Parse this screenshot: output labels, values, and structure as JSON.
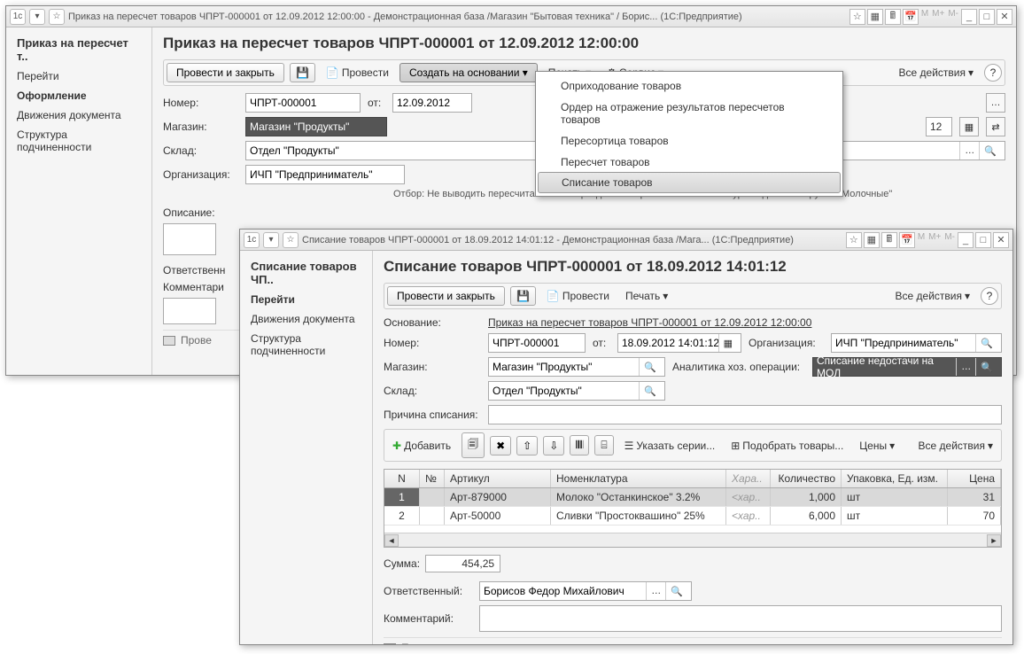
{
  "main": {
    "title": "Приказ на пересчет товаров ЧПРТ-000001 от 12.09.2012 12:00:00 - Демонстрационная база /Магазин \"Бытовая техника\" / Борис...  (1С:Предприятие)",
    "nav": {
      "head": "Приказ на пересчет т..",
      "items": [
        "Перейти",
        "Оформление",
        "Движения документа",
        "Структура подчиненности"
      ],
      "selected": 1
    },
    "page_title": "Приказ на пересчет товаров ЧПРТ-000001 от 12.09.2012 12:00:00",
    "toolbar": {
      "post_close": "Провести и закрыть",
      "post": "Провести",
      "create_based": "Создать на основании",
      "print": "Печать",
      "service": "Сервис",
      "all_actions": "Все действия",
      "help": "?"
    },
    "dropdown": {
      "items": [
        "Оприходование товаров",
        "Ордер на отражение результатов пересчетов товаров",
        "Пересортица товаров",
        "Пересчет товаров",
        "Списание товаров"
      ],
      "selected": 4
    },
    "labels": {
      "number": "Номер:",
      "from": "от:",
      "store": "Магазин:",
      "warehouse": "Склад:",
      "org": "Организация:",
      "desc": "Описание:",
      "responsible": "Ответственн",
      "comment": "Комментари"
    },
    "fields": {
      "number": "ЧПРТ-000001",
      "date": "12.09.2012",
      "store": "Магазин \"Продукты\"",
      "warehouse": "Отдел \"Продукты\"",
      "org": "ИЧП \"Предприниматель\"",
      "due": "12"
    },
    "hint": "Отбор: Не выводить пересчитанные товары данного приказа И Номенклатура.Родитель В группе \"Молочные\"",
    "status": "Прове"
  },
  "sub": {
    "title": "Списание товаров ЧПРТ-000001 от 18.09.2012 14:01:12 - Демонстрационная база /Мага...  (1С:Предприятие)",
    "nav": {
      "head": "Списание товаров ЧП..",
      "items": [
        "Перейти",
        "Движения документа",
        "Структура подчиненности"
      ],
      "selected": 0
    },
    "page_title": "Списание товаров ЧПРТ-000001 от 18.09.2012 14:01:12",
    "toolbar": {
      "post_close": "Провести и закрыть",
      "post": "Провести",
      "print": "Печать",
      "all_actions": "Все действия",
      "help": "?"
    },
    "labels": {
      "basis": "Основание:",
      "number": "Номер:",
      "from": "от:",
      "org": "Организация:",
      "store": "Магазин:",
      "analytics": "Аналитика хоз. операции:",
      "warehouse": "Склад:",
      "reason": "Причина списания:",
      "sum": "Сумма:",
      "responsible": "Ответственный:",
      "comment": "Комментарий:"
    },
    "fields": {
      "basis": "Приказ на пересчет товаров ЧПРТ-000001 от 12.09.2012 12:00:00",
      "number": "ЧПРТ-000001",
      "date": "18.09.2012 14:01:12",
      "org": "ИЧП \"Предприниматель\"",
      "store": "Магазин \"Продукты\"",
      "analytics": "Списание недостачи на МОЛ",
      "warehouse": "Отдел \"Продукты\"",
      "sum": "454,25",
      "responsible": "Борисов Федор Михайлович"
    },
    "tabletoolbar": {
      "add": "Добавить",
      "series": "Указать серии...",
      "pick": "Подобрать товары...",
      "prices": "Цены",
      "all_actions": "Все действия"
    },
    "grid": {
      "headers": {
        "n": "N",
        "ico": "№",
        "art": "Артикул",
        "nom": "Номенклатура",
        "chr": "Хара..",
        "qty": "Количество",
        "pkg": "Упаковка, Ед. изм.",
        "prc": "Цена"
      },
      "rows": [
        {
          "n": "1",
          "art": "Арт-879000",
          "nom": "Молоко \"Останкинское\" 3.2%",
          "chr": "<хар..",
          "qty": "1,000",
          "pkg": "шт",
          "prc": "31"
        },
        {
          "n": "2",
          "art": "Арт-50000",
          "nom": "Сливки \"Простоквашино\" 25%",
          "chr": "<хар..",
          "qty": "6,000",
          "pkg": "шт",
          "prc": "70"
        }
      ]
    },
    "status": "Проведен"
  }
}
